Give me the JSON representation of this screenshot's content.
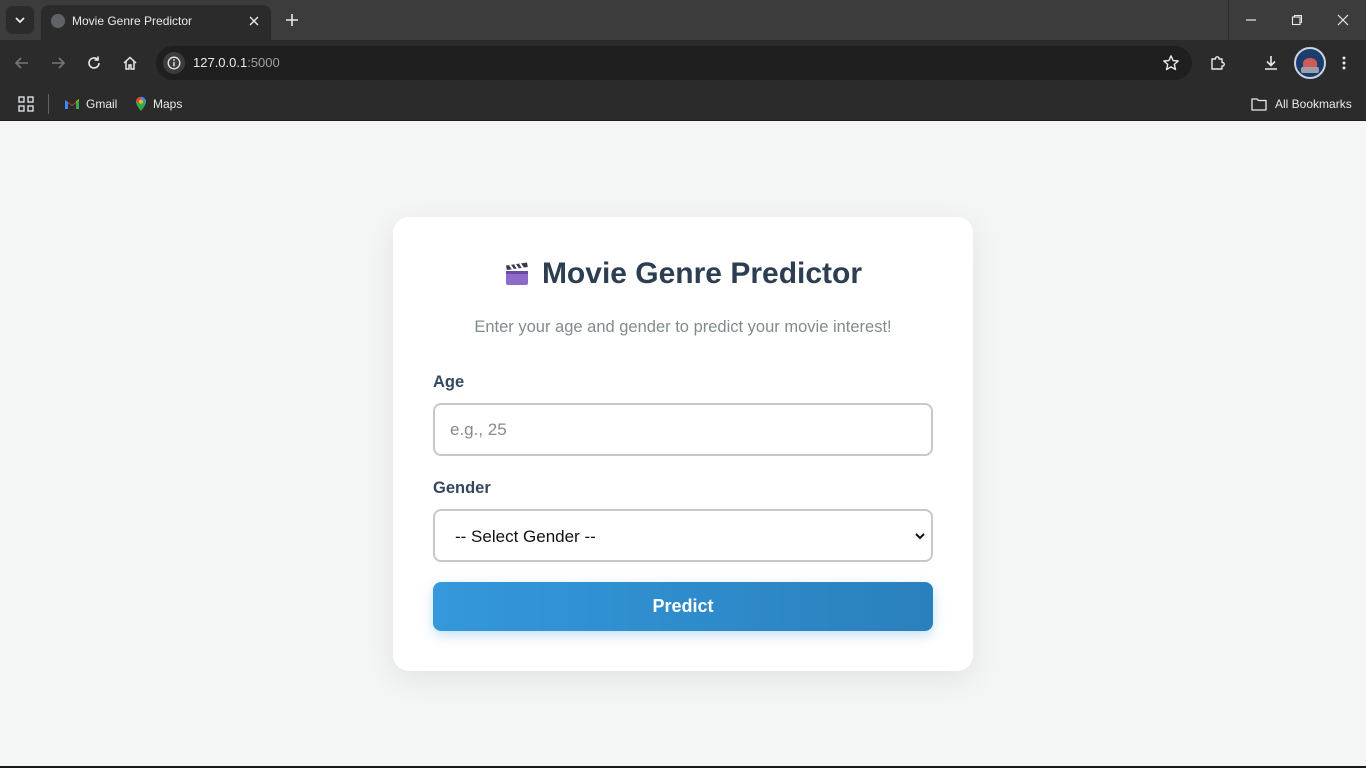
{
  "browser": {
    "tab": {
      "title": "Movie Genre Predictor"
    },
    "address": {
      "host": "127.0.0.1",
      "port": ":5000"
    },
    "bookmarks": [
      {
        "label": "Gmail",
        "icon": "gmail-icon"
      },
      {
        "label": "Maps",
        "icon": "maps-icon"
      }
    ],
    "all_bookmarks_label": "All Bookmarks"
  },
  "page": {
    "title": "Movie Genre Predictor",
    "title_icon": "clapperboard-icon",
    "subtitle": "Enter your age and gender to predict your movie interest!",
    "age": {
      "label": "Age",
      "placeholder": "e.g., 25",
      "value": ""
    },
    "gender": {
      "label": "Gender",
      "selected": "-- Select Gender --"
    },
    "submit_label": "Predict"
  },
  "colors": {
    "accent": "#3498db",
    "title_text": "#2c3e50",
    "subtitle_text": "#7f8c8d",
    "page_background": "#f4f6f6"
  }
}
